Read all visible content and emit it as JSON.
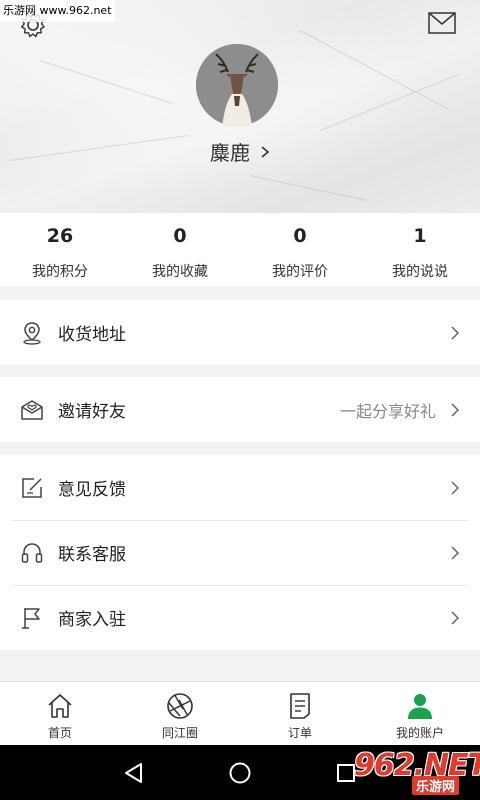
{
  "watermark": "乐游网 www.962.net",
  "profile": {
    "name": "麋鹿"
  },
  "stats": [
    {
      "value": "26",
      "label": "我的积分"
    },
    {
      "value": "0",
      "label": "我的收藏"
    },
    {
      "value": "0",
      "label": "我的评价"
    },
    {
      "value": "1",
      "label": "我的说说"
    }
  ],
  "menu": {
    "address": "收货地址",
    "invite": "邀请好友",
    "invite_hint": "一起分享好礼",
    "feedback": "意见反馈",
    "service": "联系客服",
    "merchant": "商家入驻"
  },
  "tabs": [
    {
      "label": "首页",
      "icon": "home-icon"
    },
    {
      "label": "同江圈",
      "icon": "aperture-icon"
    },
    {
      "label": "订单",
      "icon": "order-icon"
    },
    {
      "label": "我的账户",
      "icon": "user-icon"
    }
  ],
  "colors": {
    "accent": "#1aa34a",
    "background": "#f2f2f2",
    "brand": "#e03a2d"
  },
  "brand": {
    "main": "962.NET",
    "sub": "乐游网"
  }
}
